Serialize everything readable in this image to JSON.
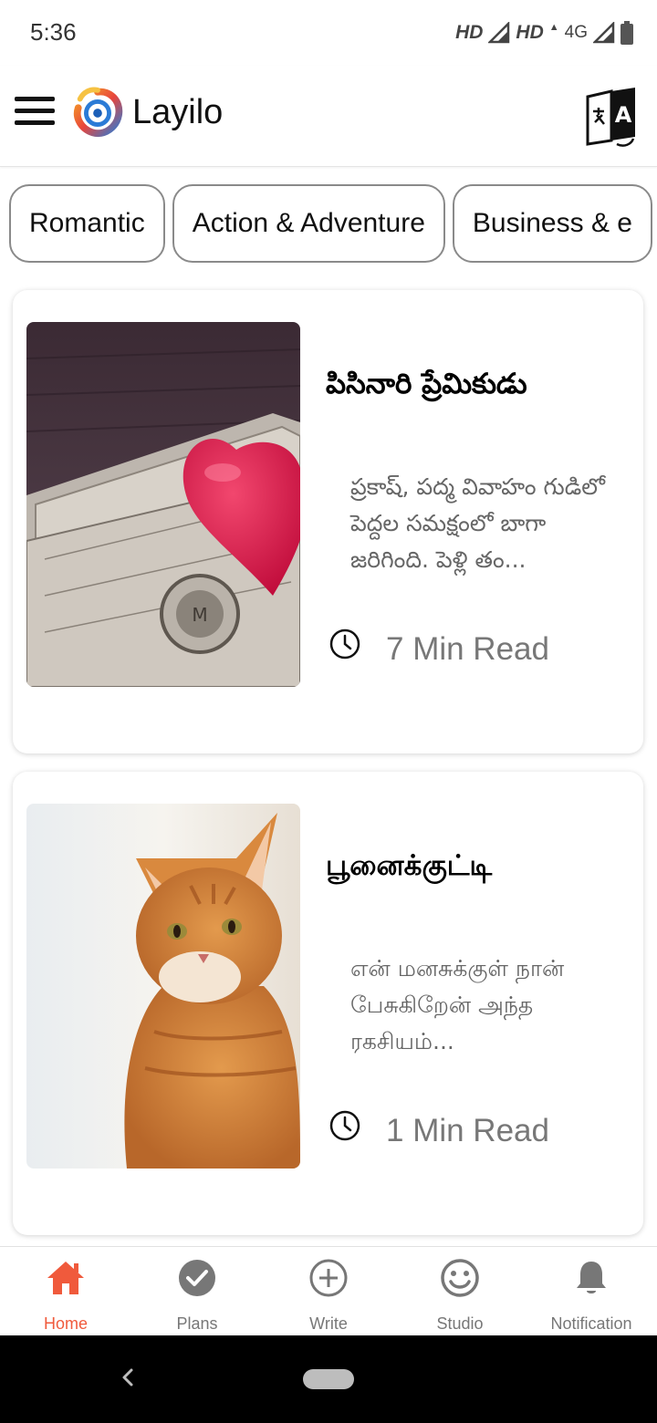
{
  "status_bar": {
    "time": "5:36",
    "network_1": "HD",
    "network_2": "HD",
    "network_3": "4G"
  },
  "app_bar": {
    "title": "Layilo",
    "menu_icon": "hamburger-menu-icon",
    "translate_icon": "translate-icon"
  },
  "categories": [
    {
      "label": "Romantic"
    },
    {
      "label": "Action & Adventure"
    },
    {
      "label": "Business & e"
    }
  ],
  "stories": [
    {
      "title": "పిసినారి ప్రేమికుడు",
      "excerpt": "ప్రకాష్, పద్మ వివాహం గుడిలో పెద్దల సమక్షంలో బాగా జరిగింది. పెళ్లి తం...",
      "read_time": "7 Min Read",
      "image": "money-heart-photo"
    },
    {
      "title": "பூனைக்குட்டி",
      "excerpt": "என் மனசுக்குள் நான் பேசுகிறேன் அந்த ரகசியம்...",
      "read_time": "1 Min Read",
      "image": "orange-cat-photo"
    }
  ],
  "bottom_nav": {
    "items": [
      {
        "label": "Home",
        "icon": "home-icon",
        "active": true
      },
      {
        "label": "Plans",
        "icon": "check-circle-icon",
        "active": false
      },
      {
        "label": "Write",
        "icon": "add-circle-icon",
        "active": false
      },
      {
        "label": "Studio",
        "icon": "smiley-icon",
        "active": false
      },
      {
        "label": "Notification",
        "icon": "bell-icon",
        "active": false
      }
    ]
  },
  "colors": {
    "accent": "#f05a3c",
    "text_primary": "#000000",
    "text_secondary": "#666666",
    "nav_inactive": "#777777"
  }
}
